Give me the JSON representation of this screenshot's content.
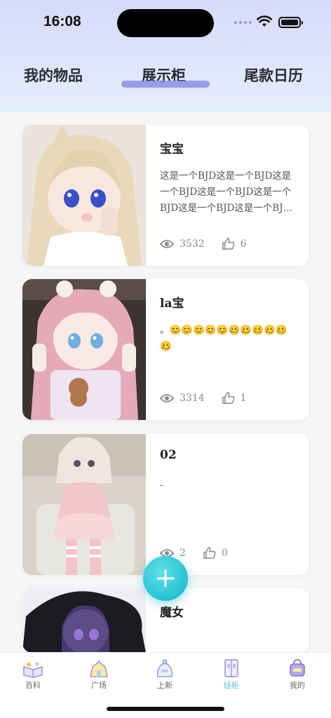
{
  "status": {
    "time": "16:08"
  },
  "tabs": [
    {
      "label": "我的物品"
    },
    {
      "label": "展示柜"
    },
    {
      "label": "尾款日历"
    }
  ],
  "cards": [
    {
      "title": "宝宝",
      "desc": "这是一个BJD这是一个BJD这是一个BJD这是一个BJD这是一个BJD这是一个BJD这是一个BJ…",
      "views": "3532",
      "likes": "6"
    },
    {
      "title": "la宝",
      "desc": "。😊😊😊😊😊🥴🥴🥴🥴🥴🥴",
      "views": "3314",
      "likes": "1"
    },
    {
      "title": "02",
      "desc": "-",
      "views": "2",
      "likes": "0"
    },
    {
      "title": "魔女",
      "desc": "",
      "views": "",
      "likes": ""
    }
  ],
  "nav": [
    {
      "label": "百科",
      "icon": "book-icon"
    },
    {
      "label": "广场",
      "icon": "plaza-icon"
    },
    {
      "label": "上新",
      "icon": "new-icon"
    },
    {
      "label": "娃柜",
      "icon": "cabinet-icon"
    },
    {
      "label": "我的",
      "icon": "profile-icon"
    }
  ],
  "colors": {
    "accent": "#56c6d4",
    "tab_indicator": "#8a8ee8",
    "fab": "#27c3d3"
  }
}
